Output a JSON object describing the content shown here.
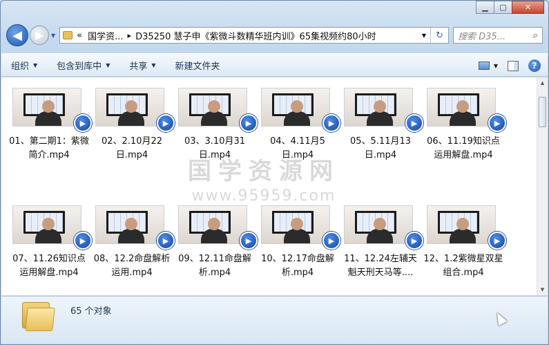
{
  "window": {
    "caption_buttons": {
      "minimize": "▁",
      "maximize": "▢",
      "close": "✕"
    }
  },
  "nav": {
    "back_icon": "◀",
    "forward_icon": "▶",
    "breadcrumb": {
      "chevrons": "«",
      "root": "国学资...",
      "separator": "▸",
      "current": "D35250 慧子申《紫微斗数精华班内训》65集视频约80小时"
    },
    "refresh_icon": "↻",
    "search_placeholder": "搜索 D35...",
    "search_icon": "⌕"
  },
  "toolbar": {
    "organize": "组织",
    "include_in_library": "包含到库中",
    "share": "共享",
    "new_folder": "新建文件夹"
  },
  "watermark": {
    "line1": "国学资源网",
    "line2": "www.95959.com"
  },
  "files": [
    {
      "name": "01、第二期1：紫微简介.mp4"
    },
    {
      "name": "02、2.10月22日.mp4"
    },
    {
      "name": "03、3.10月31日.mp4"
    },
    {
      "name": "04、4.11月5日.mp4"
    },
    {
      "name": "05、5.11月13日.mp4"
    },
    {
      "name": "06、11.19知识点运用解盘.mp4"
    },
    {
      "name": "07、11.26知识点运用解盘.mp4"
    },
    {
      "name": "08、12.2命盘解析运用.mp4"
    },
    {
      "name": "09、12.11命盘解析.mp4"
    },
    {
      "name": "10、12.17命盘解析.mp4"
    },
    {
      "name": "11、12.24左辅天魁天刑天马等...."
    },
    {
      "name": "12、1.2紫微星双星组合.mp4"
    }
  ],
  "status": {
    "count_text": "65 个对象"
  },
  "icons": {
    "video_badge": "video-player-icon",
    "folder": "folder-icon"
  }
}
